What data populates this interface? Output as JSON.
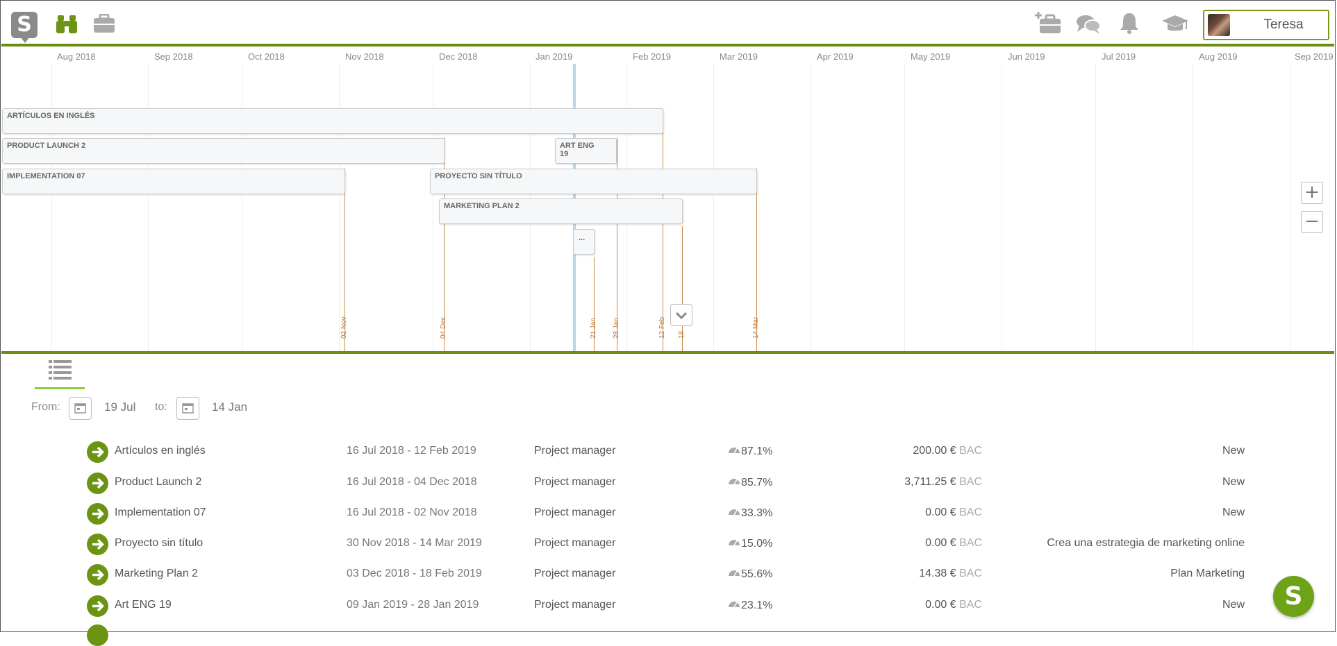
{
  "header": {
    "logo_letter": "S",
    "user_name": "Teresa",
    "icons": [
      "binoculars-icon",
      "briefcase-icon",
      "add-project-icon",
      "chat-icon",
      "bell-icon",
      "graduation-cap-icon"
    ],
    "colors": {
      "accent": "#6b8e12",
      "fab": "#6fa317",
      "deadline": "#c07a2e"
    }
  },
  "timeline": {
    "months": [
      "Aug 2018",
      "Sep 2018",
      "Oct 2018",
      "Nov 2018",
      "Dec 2018",
      "Jan 2019",
      "Feb 2019",
      "Mar 2019",
      "Apr 2019",
      "May 2019",
      "Jun 2019",
      "Jul 2019",
      "Aug 2019",
      "Sep 2019"
    ],
    "bars": [
      {
        "label": "ARTÍCULOS EN INGLÉS"
      },
      {
        "label": "PRODUCT LAUNCH 2"
      },
      {
        "label": "ART ENG 19"
      },
      {
        "label": "IMPLEMENTATION 07"
      },
      {
        "label": "PROYECTO SIN TÍTULO"
      },
      {
        "label": "MARKETING PLAN 2"
      },
      {
        "label": "..."
      }
    ],
    "deadlines": [
      "02 Nov",
      "04 Dec",
      "21 Jan",
      "28 Jan",
      "12 Feb",
      "18",
      "14 Mar"
    ],
    "zoom_in": "+",
    "zoom_out": "−"
  },
  "filters": {
    "from_label": "From:",
    "from_value": "19 Jul",
    "to_label": "to:",
    "to_value": "14 Jan"
  },
  "projects": [
    {
      "name": "Artículos en inglés",
      "dates": "16 Jul 2018 - 12 Feb 2019",
      "role": "Project manager",
      "progress": "87.1%",
      "budget": "200.00 €",
      "bac": "BAC",
      "status": "New"
    },
    {
      "name": "Product Launch 2",
      "dates": "16 Jul 2018 - 04 Dec 2018",
      "role": "Project manager",
      "progress": "85.7%",
      "budget": "3,711.25 €",
      "bac": "BAC",
      "status": "New"
    },
    {
      "name": "Implementation 07",
      "dates": "16 Jul 2018 - 02 Nov 2018",
      "role": "Project manager",
      "progress": "33.3%",
      "budget": "0.00 €",
      "bac": "BAC",
      "status": "New"
    },
    {
      "name": "Proyecto sin título",
      "dates": "30 Nov 2018 - 14 Mar 2019",
      "role": "Project manager",
      "progress": "15.0%",
      "budget": "0.00 €",
      "bac": "BAC",
      "status": "Crea una estrategia de marketing online"
    },
    {
      "name": "Marketing Plan 2",
      "dates": "03 Dec 2018 - 18 Feb 2019",
      "role": "Project manager",
      "progress": "55.6%",
      "budget": "14.38 €",
      "bac": "BAC",
      "status": "Plan Marketing"
    },
    {
      "name": "Art ENG 19",
      "dates": "09 Jan 2019 - 28 Jan 2019",
      "role": "Project manager",
      "progress": "23.1%",
      "budget": "0.00 €",
      "bac": "BAC",
      "status": "New"
    }
  ],
  "fab_letter": "S"
}
